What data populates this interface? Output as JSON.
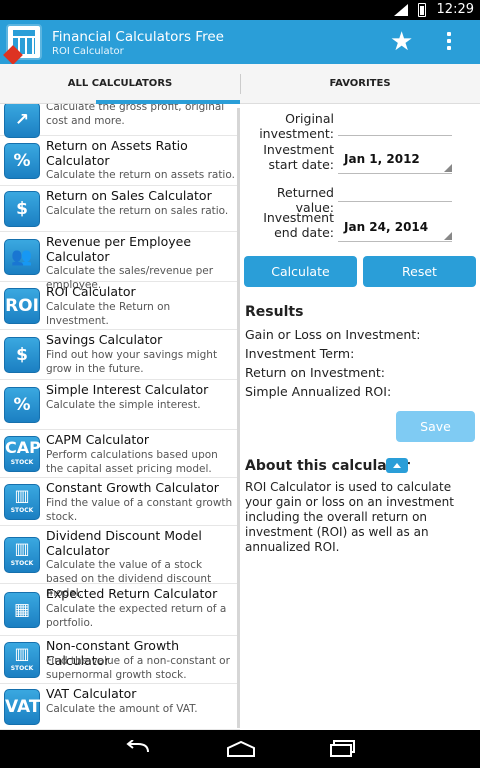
{
  "status": {
    "time": "12:29"
  },
  "app": {
    "title": "Financial Calculators Free",
    "subtitle": "ROI Calculator",
    "favorite_icon": "star-icon",
    "menu_icon": "overflow-menu-icon"
  },
  "tabs": [
    {
      "label": "ALL CALCULATORS",
      "active": true
    },
    {
      "label": "FAVORITES",
      "active": false
    }
  ],
  "calculators": [
    {
      "icon": "trend-up-icon",
      "glyph": "↗",
      "title": "",
      "desc": "Calculate the gross profit, original cost and more."
    },
    {
      "icon": "percent-icon",
      "glyph": "%",
      "title": "Return on Assets Ratio Calculator",
      "desc": "Calculate the return on assets ratio."
    },
    {
      "icon": "money-bags-icon",
      "glyph": "$",
      "title": "Return on Sales Calculator",
      "desc": "Calculate the return on sales ratio."
    },
    {
      "icon": "people-icon",
      "glyph": "👥",
      "title": "Revenue per Employee Calculator",
      "desc": "Calculate the sales/revenue per employee."
    },
    {
      "icon": "roi-icon",
      "glyph": "ROI",
      "title": "ROI Calculator",
      "desc": "Calculate the Return on Investment."
    },
    {
      "icon": "piggy-bank-icon",
      "glyph": "$",
      "title": "Savings Calculator",
      "desc": "Find out how your savings might grow in the future."
    },
    {
      "icon": "percent-badge-icon",
      "glyph": "%",
      "title": "Simple Interest Calculator",
      "desc": "Calculate the simple interest."
    },
    {
      "icon": "capm-stock-icon",
      "glyph": "CAPM",
      "badge": "STOCK",
      "title": "CAPM Calculator",
      "desc": "Perform calculations based upon the capital asset pricing model."
    },
    {
      "icon": "stock-chart-icon",
      "glyph": "▥",
      "badge": "STOCK",
      "title": "Constant Growth Calculator",
      "desc": "Find the value of a constant growth stock."
    },
    {
      "icon": "stock-chart-icon",
      "glyph": "▥",
      "badge": "STOCK",
      "title": "Dividend Discount Model Calculator",
      "desc": "Calculate the value of a stock based on the dividend discount model."
    },
    {
      "icon": "calculator-icon",
      "glyph": "▦",
      "title": "Expected Return Calculator",
      "desc": "Calculate the expected return of a portfolio."
    },
    {
      "icon": "stock-chart-icon",
      "glyph": "▥",
      "badge": "STOCK",
      "title": "Non-constant Growth Calculator",
      "desc": "Find the value of a non-constant or supernormal growth stock."
    },
    {
      "icon": "vat-icon",
      "glyph": "VAT",
      "title": "VAT Calculator",
      "desc": "Calculate the amount of VAT."
    }
  ],
  "form": {
    "original_label": "Original investment:",
    "start_label": "Investment start date:",
    "start_value": "Jan 1, 2012",
    "returned_label": "Returned value:",
    "end_label": "Investment end date:",
    "end_value": "Jan 24, 2014",
    "calculate": "Calculate",
    "reset": "Reset"
  },
  "results": {
    "heading": "Results",
    "gain": "Gain or Loss on Investment:",
    "term": "Investment Term:",
    "roi": "Return on Investment:",
    "annual": "Simple Annualized ROI:",
    "save": "Save"
  },
  "about": {
    "heading": "About this calculator",
    "text": "ROI Calculator is used to calculate your gain or loss on an investment including the overall return on investment (ROI) as well as an annualized ROI."
  },
  "nav": {
    "back_icon": "back-icon",
    "home_icon": "home-icon",
    "recents_icon": "recents-icon"
  },
  "colors": {
    "accent": "#2a9ed8",
    "save_button": "#7fcbf3"
  }
}
